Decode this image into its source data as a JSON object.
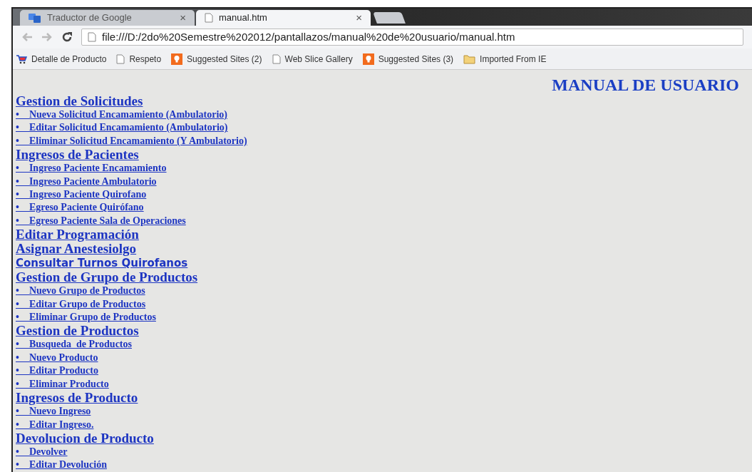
{
  "browser": {
    "tabs": [
      {
        "title": "Traductor de Google",
        "close": "×",
        "selected": false,
        "kind": "translate"
      },
      {
        "title": "manual.htm",
        "close": "×",
        "selected": true,
        "kind": "page"
      }
    ],
    "address": "file:///D:/2do%20Semestre%202012/pantallazos/manual%20de%20usuario/manual.htm",
    "bookmarks": [
      {
        "label": "Detalle de Producto",
        "kind": "cart"
      },
      {
        "label": "Respeto",
        "kind": "page"
      },
      {
        "label": "Suggested Sites (2)",
        "kind": "bulb"
      },
      {
        "label": "Web Slice Gallery",
        "kind": "page"
      },
      {
        "label": "Suggested Sites (3)",
        "kind": "bulb"
      },
      {
        "label": "Imported From IE",
        "kind": "folder"
      }
    ]
  },
  "page": {
    "title": "MANUAL DE USUARIO",
    "sections": [
      {
        "heading": "Gestion de Solicitudes",
        "kind": "serif",
        "items": [
          "•    Nueva Solicitud Encamamiento (Ambulatorio)",
          "•    Editar Solicitud Encamamiento (Ambulatorio)",
          "•    Eliminar Solicitud Encamamiento (Y Ambulatorio)"
        ]
      },
      {
        "heading": "Ingresos de Pacientes",
        "kind": "serif",
        "items": [
          "•    Ingreso Paciente Encamamiento",
          "•    Ingreso Paciente Ambulatorio",
          "•    Ingreso Paciente Quirofano",
          "•    Egreso Paciente Quirófano",
          "•    Egreso Paciente Sala de Operaciones"
        ]
      },
      {
        "heading": "Editar Programación",
        "kind": "serif"
      },
      {
        "heading": "Asignar Anestesiolgo",
        "kind": "serif"
      },
      {
        "heading": "Consultar Turnos Quirofanos",
        "kind": "sans"
      },
      {
        "heading": "Gestion de Grupo de Productos",
        "kind": "serif",
        "items": [
          "•    Nuevo Grupo de Productos",
          "•    Editar Grupo de Productos",
          "•    Eliminar Grupo de Productos"
        ]
      },
      {
        "heading": "Gestion de Productos",
        "kind": "serif",
        "items": [
          "•    Busqueda  de Productos",
          "•    Nuevo Producto",
          "•    Editar Producto",
          "•    Eliminar Producto"
        ]
      },
      {
        "heading": "Ingresos de Producto",
        "kind": "serif",
        "items": [
          "•    Nuevo Ingreso",
          "•    Editar Ingreso."
        ]
      },
      {
        "heading": "Devolucion de Producto",
        "kind": "serif",
        "items": [
          "•    Devolver",
          "•    Editar Devolución"
        ]
      }
    ]
  }
}
